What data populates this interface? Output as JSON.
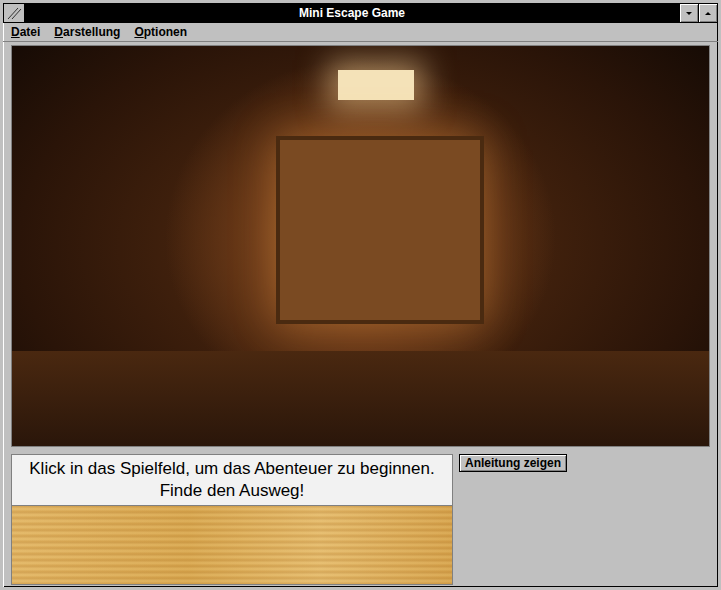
{
  "window": {
    "title": "Mini Escape Game"
  },
  "menu": [
    {
      "label": "Datei",
      "mnemonic_index": 0
    },
    {
      "label": "Darstellung",
      "mnemonic_index": 0
    },
    {
      "label": "Optionen",
      "mnemonic_index": 0
    }
  ],
  "message": {
    "text": "Klick in das Spielfeld, um das Abenteuer zu beginnen. Finde den Ausweg!"
  },
  "buttons": [
    {
      "label": "Anleitung zeigen"
    }
  ]
}
